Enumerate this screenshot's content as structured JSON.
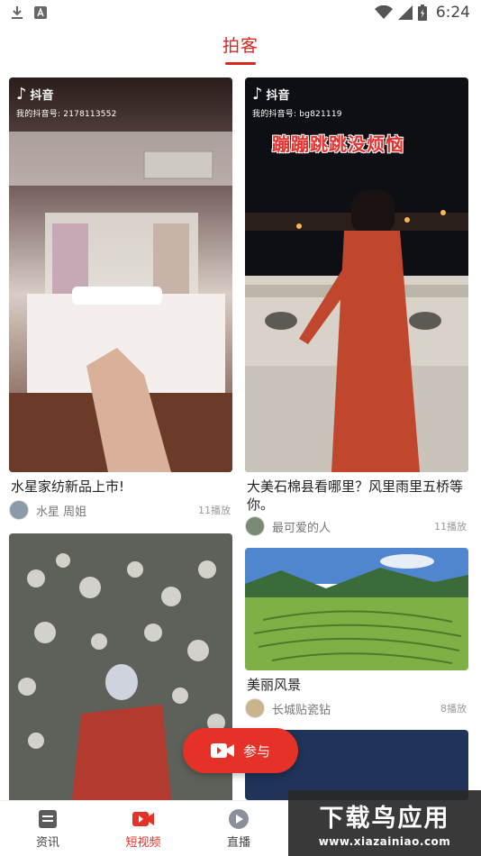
{
  "status_bar": {
    "time": "6:24"
  },
  "header": {
    "title": "拍客"
  },
  "feed": {
    "cards": [
      {
        "title": "水星家纺新品上市!",
        "author": "水星 周姐",
        "plays": "11播放",
        "tiktok_label": "抖音",
        "tiktok_id": "我的抖音号: 2178113552"
      },
      {
        "title": "大美石棉县看哪里？风里雨里五桥等你。",
        "author": "最可爱的人",
        "plays": "11播放",
        "tiktok_label": "抖音",
        "tiktok_id": "我的抖音号: bg821119",
        "overlay_caption": "蹦蹦跳跳没烦恼"
      },
      {
        "title": "",
        "author": "",
        "plays": ""
      },
      {
        "title": "美丽风景",
        "author": "长城贴瓷钻",
        "plays": "8播放"
      }
    ]
  },
  "join_button": {
    "label": "参与"
  },
  "bottom_nav": {
    "items": [
      {
        "label": "资讯",
        "icon": "news-icon"
      },
      {
        "label": "短视频",
        "icon": "video-camera-icon"
      },
      {
        "label": "直播",
        "icon": "play-circle-icon"
      }
    ],
    "active_index": 1
  },
  "watermark": {
    "main": "下载鸟应用",
    "sub": "www.xiazainiao.com"
  },
  "colors": {
    "accent": "#e53127",
    "title_red": "#d8281e"
  }
}
